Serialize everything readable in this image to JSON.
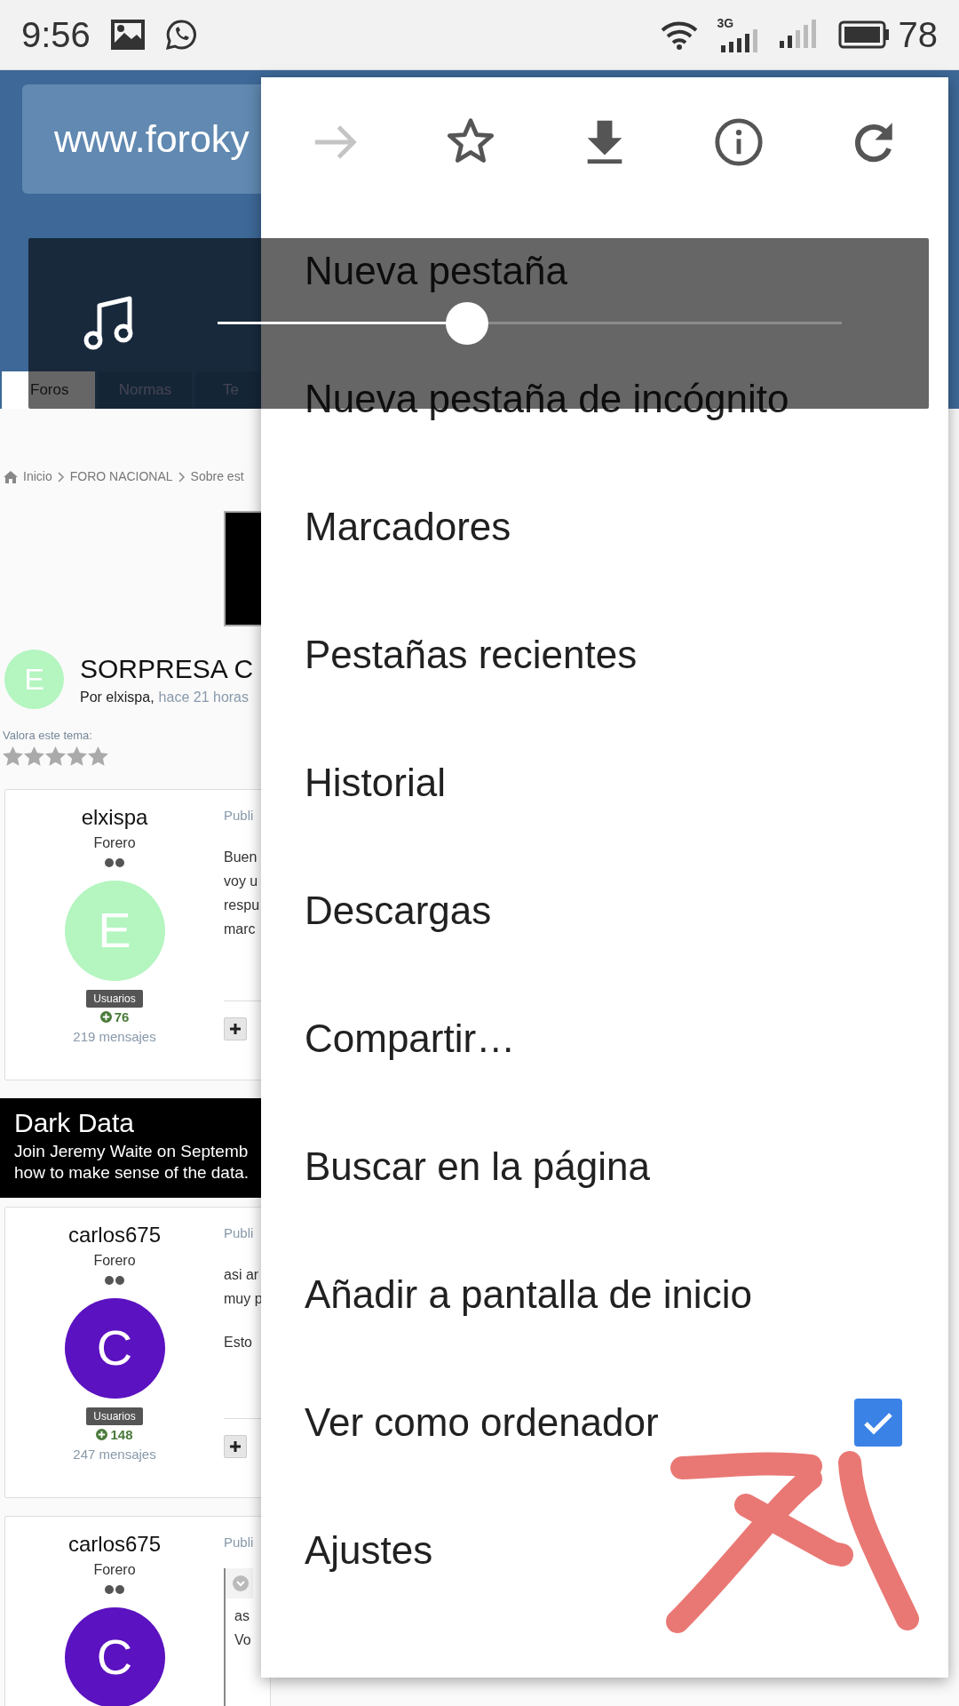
{
  "status_bar": {
    "time": "9:56",
    "network": "3G",
    "battery": "78"
  },
  "page": {
    "url": "www.foroky",
    "tabs": [
      {
        "label": "Foros",
        "selected": true
      },
      {
        "label": "Normas",
        "selected": false
      },
      {
        "label": "Te",
        "selected": false
      }
    ],
    "breadcrumb": [
      "Inicio",
      "FORO NACIONAL",
      "Sobre est"
    ],
    "topic": {
      "initial": "E",
      "title": "SORPRESA C",
      "byline": "Por elxispa,",
      "time": "hace 21 horas"
    },
    "rating": {
      "label": "Valora este tema:",
      "stars": 0
    },
    "posts": [
      {
        "author": "elxispa",
        "rank": "Forero",
        "initial": "E",
        "color": "#b4f5c0",
        "group": "Usuarios",
        "reputation": "76",
        "count": "219 mensajes",
        "label": "Publi",
        "blocks": [
          {
            "kind": "text",
            "lines": [
              "Buen",
              "voy u",
              "respu",
              "marc"
            ]
          }
        ],
        "actions": true
      },
      {
        "author": "carlos675",
        "rank": "Forero",
        "initial": "C",
        "color": "#5b12c0",
        "group": "Usuarios",
        "reputation": "148",
        "count": "247 mensajes",
        "label": "Publi",
        "blocks": [
          {
            "kind": "text",
            "lines": [
              "asi ar",
              "muy p"
            ]
          },
          {
            "kind": "text",
            "lines": [
              "Esto"
            ]
          }
        ],
        "actions": true
      },
      {
        "author": "carlos675",
        "rank": "Forero",
        "initial": "C",
        "color": "#5b12c0",
        "label": "Publi",
        "blocks": [
          {
            "kind": "quote",
            "lines": [
              "as",
              "Vo"
            ]
          }
        ],
        "actions": false
      }
    ],
    "ad": {
      "title": "Dark Data",
      "lines": [
        "Join Jeremy Waite on Septemb",
        "how to make sense of the data."
      ]
    }
  },
  "volume": {
    "level": 0.4
  },
  "menu": {
    "toolbar": [
      {
        "kind": "forward",
        "disabled": true
      },
      {
        "kind": "bookmark",
        "disabled": false
      },
      {
        "kind": "download",
        "disabled": false
      },
      {
        "kind": "info",
        "disabled": false
      },
      {
        "kind": "reload",
        "disabled": false
      }
    ],
    "items": [
      {
        "kind": "plain",
        "label": "Nueva pestaña"
      },
      {
        "kind": "plain",
        "label": "Nueva pestaña de incógnito"
      },
      {
        "kind": "plain",
        "label": "Marcadores"
      },
      {
        "kind": "plain",
        "label": "Pestañas recientes"
      },
      {
        "kind": "plain",
        "label": "Historial"
      },
      {
        "kind": "plain",
        "label": "Descargas"
      },
      {
        "kind": "plain",
        "label": "Compartir…"
      },
      {
        "kind": "plain",
        "label": "Buscar en la página"
      },
      {
        "kind": "plain",
        "label": "Añadir a pantalla de inicio"
      },
      {
        "kind": "checkbox",
        "label": "Ver como ordenador",
        "checked": true
      },
      {
        "kind": "plain",
        "label": "Ajustes"
      }
    ]
  }
}
